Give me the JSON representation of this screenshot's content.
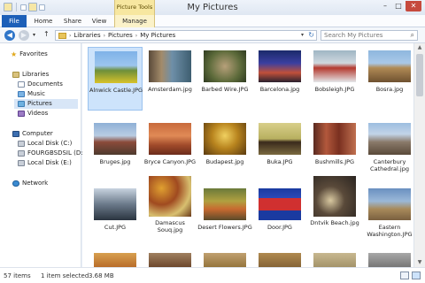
{
  "window": {
    "title": "My Pictures",
    "context_tab": "Picture Tools"
  },
  "window_buttons": {
    "minimize": "–",
    "maximize": "□",
    "close": "✕"
  },
  "ribbon": {
    "tabs": [
      "File",
      "Home",
      "Share",
      "View",
      "Manage"
    ]
  },
  "address": {
    "segments": [
      "Libraries",
      "Pictures",
      "My Pictures"
    ],
    "search_placeholder": "Search My Pictures"
  },
  "nav": {
    "favorites": "Favorites",
    "libraries": "Libraries",
    "documents": "Documents",
    "music": "Music",
    "pictures": "Pictures",
    "videos": "Videos",
    "computer": "Computer",
    "drive_c": "Local Disk (C:)",
    "drive_d": "FOURGBSDSIL (D:)",
    "drive_e": "Local Disk (E:)",
    "network": "Network"
  },
  "files": [
    {
      "name": "Alnwick Castle.JPG",
      "selected": true
    },
    {
      "name": "Amsterdam.jpg"
    },
    {
      "name": "Barbed Wire.JPG"
    },
    {
      "name": "Barcelona.jpg"
    },
    {
      "name": "Bobsleigh.JPG"
    },
    {
      "name": "Bosra.jpg"
    },
    {
      "name": "Bruges.jpg"
    },
    {
      "name": "Bryce Canyon.JPG"
    },
    {
      "name": "Budapest.jpg"
    },
    {
      "name": "Buka.JPG"
    },
    {
      "name": "Bushmills.JPG"
    },
    {
      "name": "Canterbury Cathedral.jpg"
    },
    {
      "name": "Cut.JPG"
    },
    {
      "name": "Damascus Souq.jpg"
    },
    {
      "name": "Desert Flowers.JPG"
    },
    {
      "name": "Door.JPG"
    },
    {
      "name": "Dntvik Beach.jpg"
    },
    {
      "name": "Eastern Washington.JPG"
    }
  ],
  "status": {
    "count": "57 items",
    "selection": "1 item selected",
    "size": "3.68 MB"
  },
  "colors": {
    "accent": "#1c5fb8",
    "context_tab": "#f7e7a0",
    "selection": "#cde3fb"
  }
}
